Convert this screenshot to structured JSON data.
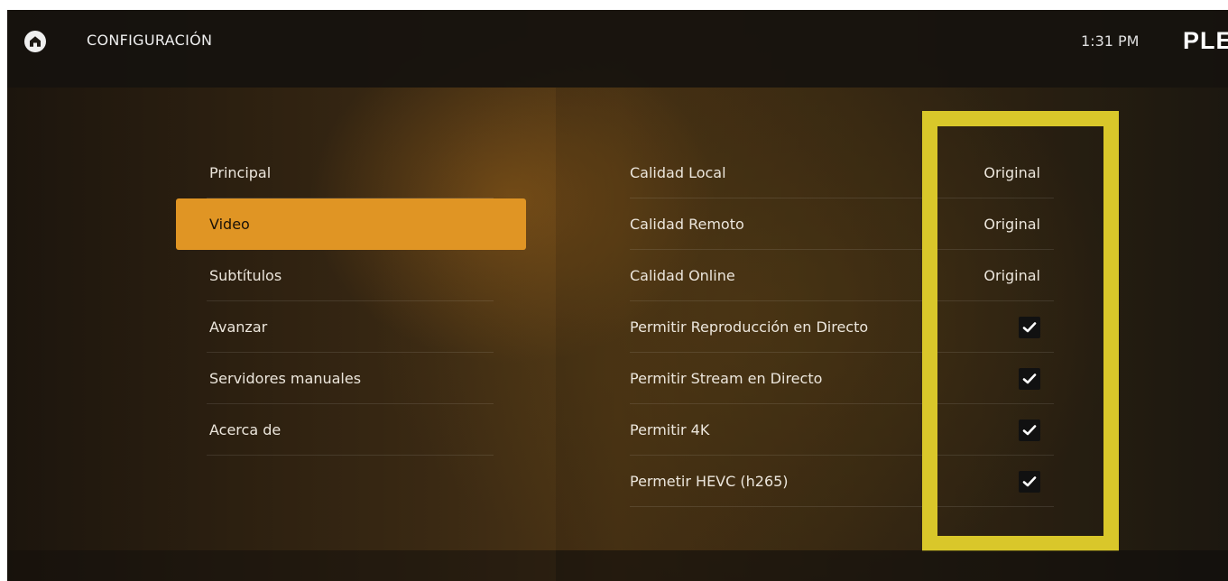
{
  "header": {
    "title": "CONFIGURACIÓN",
    "time": "1:31 PM",
    "brand": "PLE"
  },
  "menu": {
    "items": [
      {
        "label": "Principal",
        "active": false
      },
      {
        "label": "Video",
        "active": true
      },
      {
        "label": "Subtítulos",
        "active": false
      },
      {
        "label": "Avanzar",
        "active": false
      },
      {
        "label": "Servidores manuales",
        "active": false
      },
      {
        "label": "Acerca de",
        "active": false
      }
    ]
  },
  "settings": [
    {
      "label": "Calidad Local",
      "value": "Original"
    },
    {
      "label": "Calidad Remoto",
      "value": "Original"
    },
    {
      "label": "Calidad Online",
      "value": "Original"
    },
    {
      "label": "Permitir Reproducción en Directo",
      "checked": true
    },
    {
      "label": "Permitir Stream en Directo",
      "checked": true
    },
    {
      "label": "Permitir 4K",
      "checked": true
    },
    {
      "label": "Permetir HEVC (h265)",
      "checked": true
    }
  ],
  "colors": {
    "accent": "#e09524",
    "highlight_box": "#d9c72a"
  },
  "icons": {
    "home": "home-icon",
    "checkmark": "checkmark-icon"
  }
}
